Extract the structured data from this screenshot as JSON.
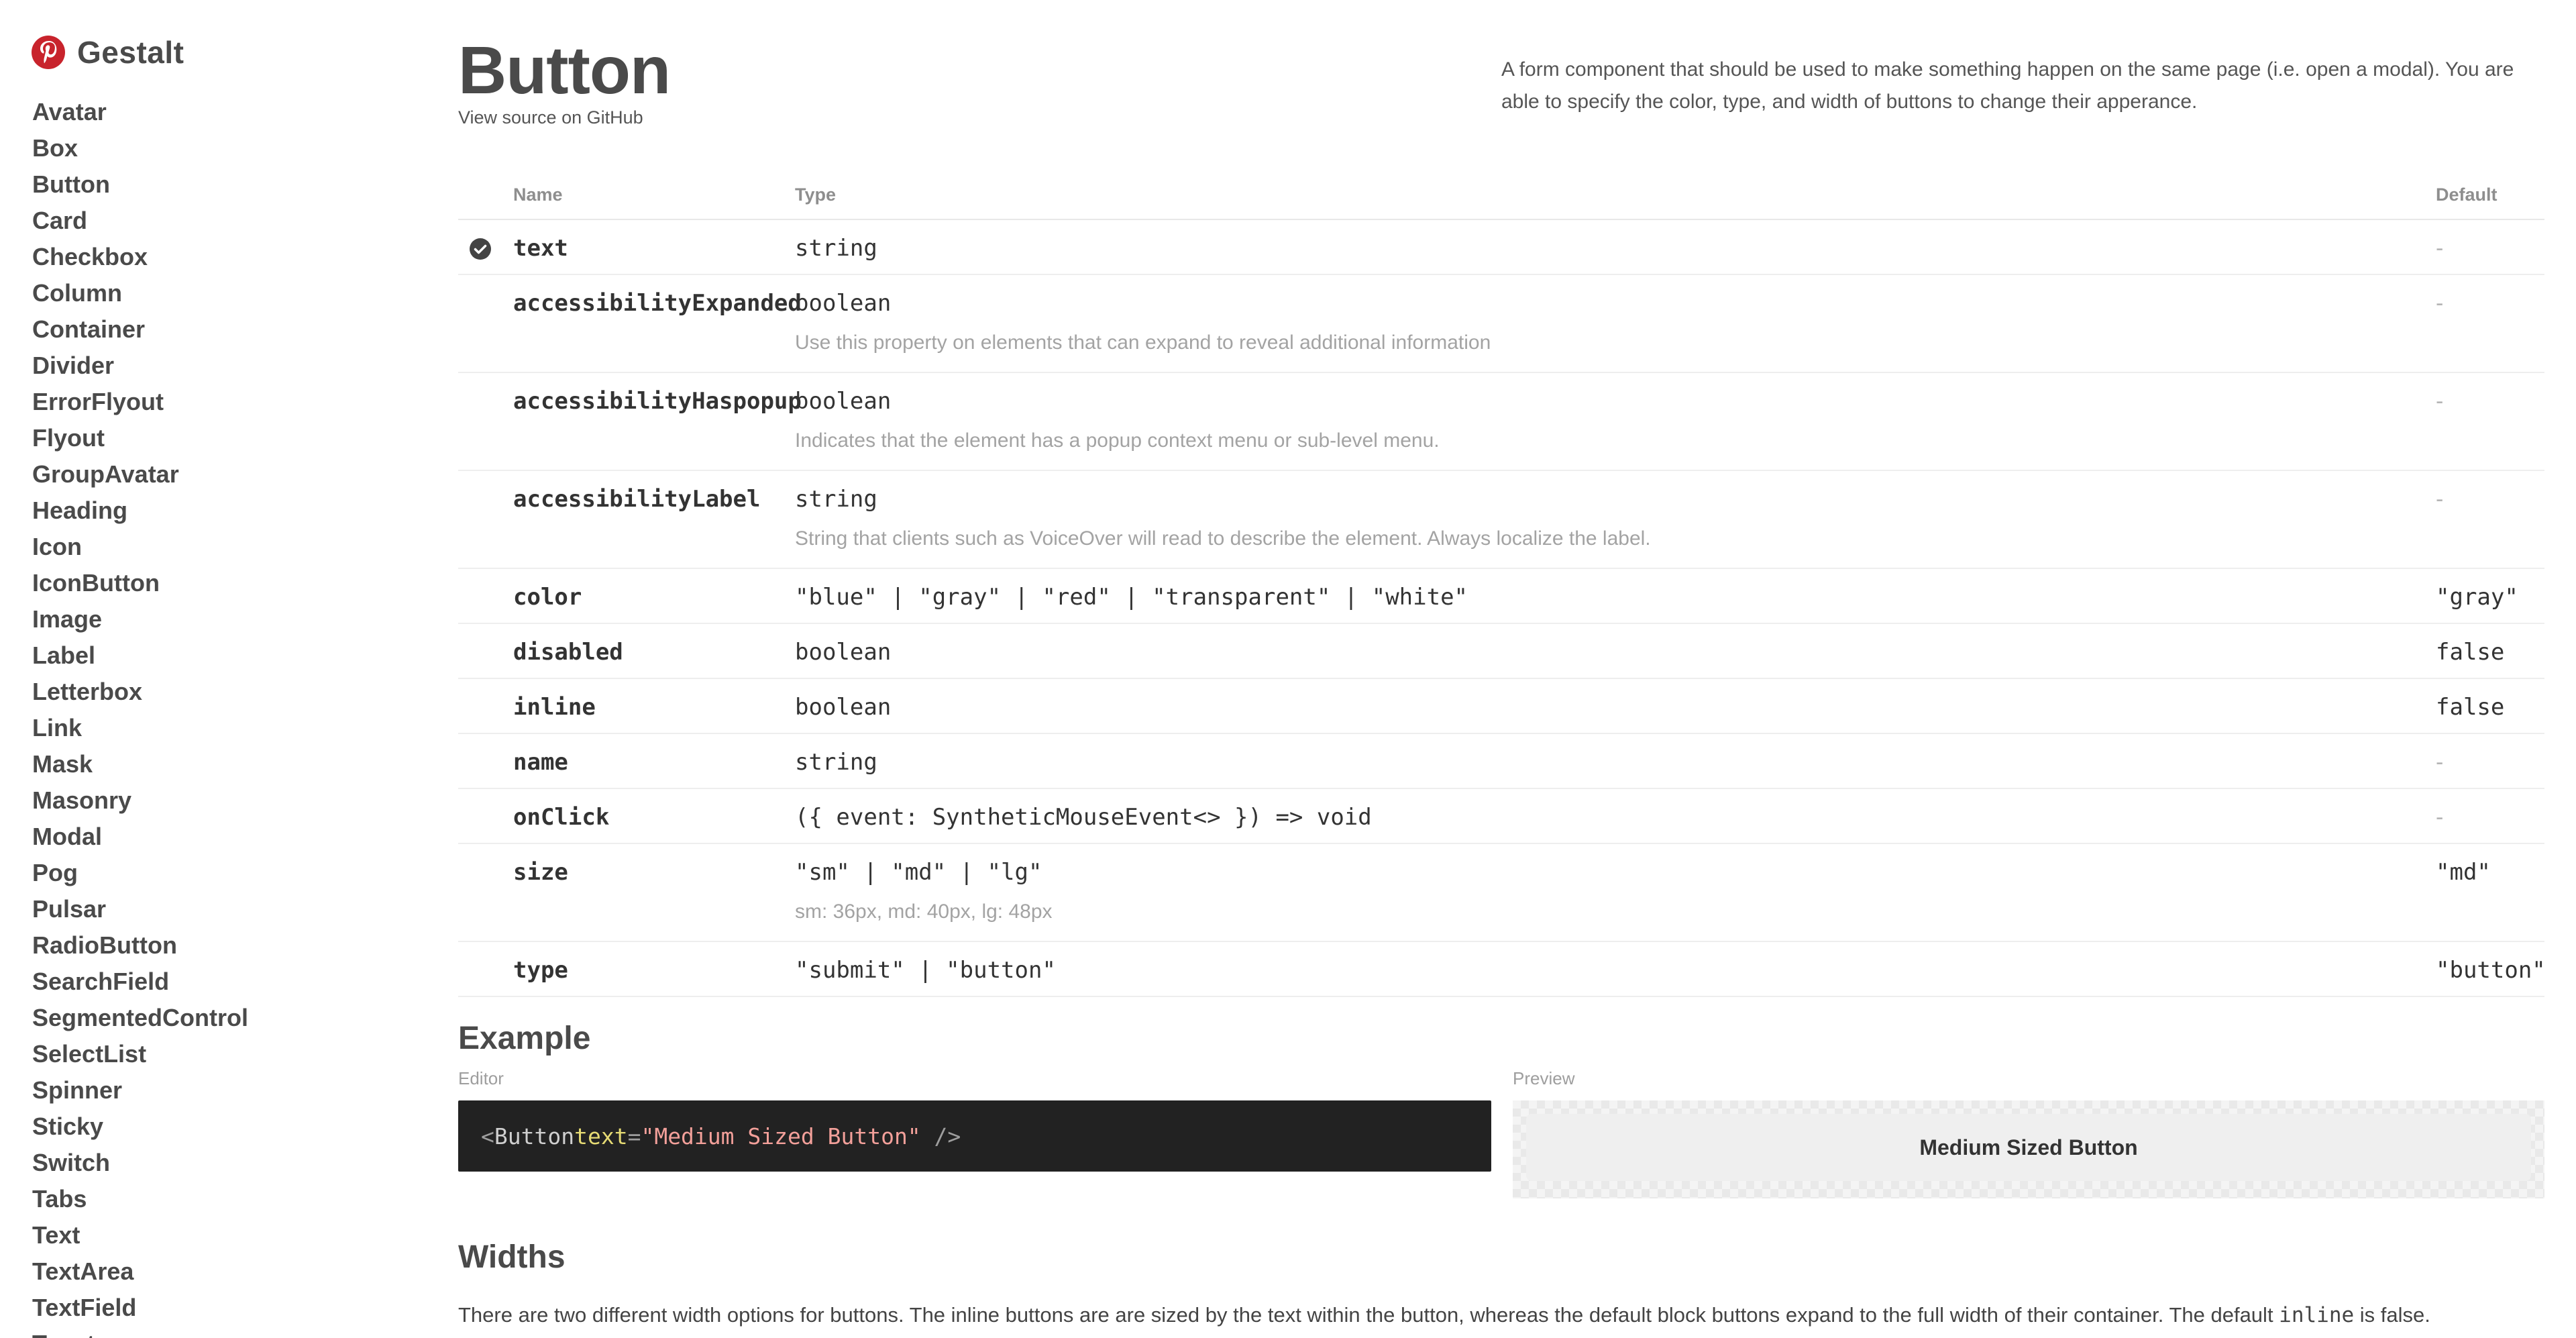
{
  "brand": {
    "name": "Gestalt",
    "logo_icon": "pinterest-logo-icon",
    "logo_color": "#c8232c"
  },
  "sidebar": {
    "items": [
      "Avatar",
      "Box",
      "Button",
      "Card",
      "Checkbox",
      "Column",
      "Container",
      "Divider",
      "ErrorFlyout",
      "Flyout",
      "GroupAvatar",
      "Heading",
      "Icon",
      "IconButton",
      "Image",
      "Label",
      "Letterbox",
      "Link",
      "Mask",
      "Masonry",
      "Modal",
      "Pog",
      "Pulsar",
      "RadioButton",
      "SearchField",
      "SegmentedControl",
      "SelectList",
      "Spinner",
      "Sticky",
      "Switch",
      "Tabs",
      "Text",
      "TextArea",
      "TextField",
      "Toast"
    ]
  },
  "page": {
    "title": "Button",
    "source_link": "View source on GitHub",
    "description": "A form component that should be used to make something happen on the same page (i.e. open a modal). You are able to specify the color, type, and width of buttons to change their apperance."
  },
  "props_table": {
    "headers": {
      "name": "Name",
      "type": "Type",
      "default": "Default"
    },
    "rows": [
      {
        "name": "text",
        "type": "string",
        "default": "-",
        "required": true
      },
      {
        "name": "accessibilityExpanded",
        "type": "boolean",
        "default": "-",
        "description": "Use this property on elements that can expand to reveal additional information"
      },
      {
        "name": "accessibilityHaspopup",
        "type": "boolean",
        "default": "-",
        "description": "Indicates that the element has a popup context menu or sub-level menu."
      },
      {
        "name": "accessibilityLabel",
        "type": "string",
        "default": "-",
        "description": "String that clients such as VoiceOver will read to describe the element. Always localize the label."
      },
      {
        "name": "color",
        "type": "\"blue\" | \"gray\" | \"red\" | \"transparent\" | \"white\"",
        "default": "\"gray\""
      },
      {
        "name": "disabled",
        "type": "boolean",
        "default": "false"
      },
      {
        "name": "inline",
        "type": "boolean",
        "default": "false"
      },
      {
        "name": "name",
        "type": "string",
        "default": "-"
      },
      {
        "name": "onClick",
        "type": "({ event: SyntheticMouseEvent<> }) => void",
        "default": "-"
      },
      {
        "name": "size",
        "type": "\"sm\" | \"md\" | \"lg\"",
        "default": "\"md\"",
        "description": "sm: 36px, md: 40px, lg: 48px"
      },
      {
        "name": "type",
        "type": "\"submit\" | \"button\"",
        "default": "\"button\""
      }
    ]
  },
  "example": {
    "title": "Example",
    "editor_label": "Editor",
    "preview_label": "Preview",
    "code": {
      "open": "<",
      "tag": "Button",
      "attr": "text",
      "eq": "=",
      "value": "\"Medium Sized Button\"",
      "close": " />"
    },
    "preview_button_label": "Medium Sized Button"
  },
  "widths": {
    "title": "Widths",
    "text_before": "There are two different width options for buttons. The inline buttons are are sized by the text within the button, whereas the default block buttons expand to the full width of their container. The default ",
    "code": "inline",
    "text_after": " is false."
  }
}
